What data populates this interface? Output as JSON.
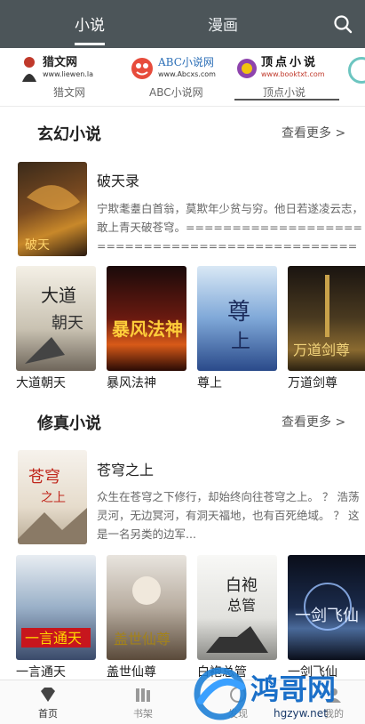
{
  "header": {
    "tabs": [
      {
        "label": "小说",
        "active": true
      },
      {
        "label": "漫画",
        "active": false
      }
    ],
    "search_icon": "search-icon"
  },
  "sources": [
    {
      "logo_text": "猎文网",
      "logo_sub": "www.liewen.la",
      "label": "猎文网"
    },
    {
      "logo_text": "ABC小说网",
      "logo_sub": "www.Abcxs.com",
      "label": "ABC小说网"
    },
    {
      "logo_text": "顶点小说",
      "logo_sub": "www.booktxt.com",
      "label": "顶点小说",
      "selected": true
    }
  ],
  "sections": [
    {
      "title": "玄幻小说",
      "more": "查看更多 >",
      "featured": {
        "title": "破天录",
        "description": "宁欺耄耋白首翁，莫欺年少贫与穷。他日若遂凌云志，敢上青天破苍穹。================================================================================ 2..."
      },
      "books": [
        "大道朝天",
        "暴风法神",
        "尊上",
        "万道剑尊"
      ]
    },
    {
      "title": "修真小说",
      "more": "查看更多 >",
      "featured": {
        "title": "苍穹之上",
        "description": "众生在苍穹之下修行，却始终向往苍穹之上。 ？ 浩荡灵河，无边冥河，有洞天福地，也有百死绝域。 ？ 这是一名另类的边军..."
      },
      "books": [
        "一言通天",
        "盖世仙尊",
        "白袍总管",
        "一剑飞仙"
      ]
    }
  ],
  "bottom_nav": [
    {
      "label": "首页",
      "icon": "home-icon",
      "active": true
    },
    {
      "label": "书架",
      "icon": "bookshelf-icon",
      "active": false
    },
    {
      "label": "发现",
      "icon": "discover-icon",
      "active": false
    },
    {
      "label": "我的",
      "icon": "profile-icon",
      "active": false
    }
  ],
  "watermark": {
    "text": "鸿哥网",
    "url": "hgzyw.net"
  },
  "colors": {
    "topbar": "#4c5559",
    "background": "#ffffff"
  }
}
